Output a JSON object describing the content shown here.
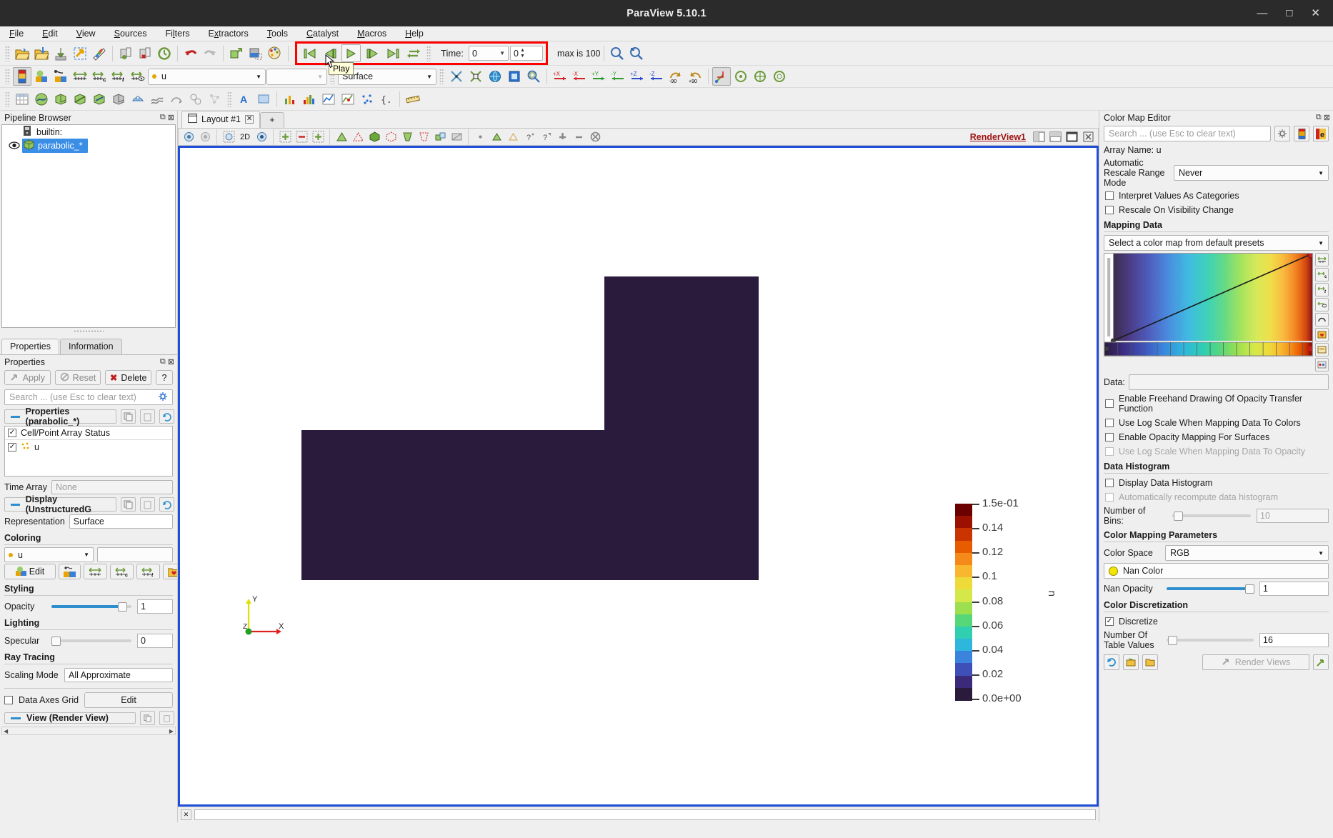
{
  "window": {
    "title": "ParaView 5.10.1",
    "minimize": "—",
    "maximize": "□",
    "close": "✕"
  },
  "menubar": {
    "items": [
      "File",
      "Edit",
      "View",
      "Sources",
      "Filters",
      "Extractors",
      "Tools",
      "Catalyst",
      "Macros",
      "Help"
    ]
  },
  "toolbar_main": {
    "icons": [
      "open-file-icon",
      "save-data-icon",
      "load-state-icon",
      "save-state-icon",
      "connect-icon",
      "disconnect-icon",
      "reset-session-icon",
      "undo-icon",
      "redo-icon",
      "camera-link-icon",
      "screenshot-icon",
      "color-palette-icon",
      "find-data-icon",
      "save-screenshot-icon"
    ]
  },
  "time_controls": {
    "highlight_color": "#ff0000",
    "first_frame": "first-frame-button",
    "previous_frame": "previous-frame-button",
    "play": "play-button",
    "next_frame": "next-frame-button",
    "last_frame": "last-frame-button",
    "loop": "loop-button",
    "time_label": "Time:",
    "time_value": "0",
    "frame_value": "0",
    "max_label": "max is 100",
    "tooltip": "Play"
  },
  "toolbar_rep": {
    "array_name": "u",
    "component_placeholder": "",
    "representation": "Surface"
  },
  "pipeline": {
    "title": "Pipeline Browser",
    "server": "builtin:",
    "source": "parabolic_*"
  },
  "properties_panel": {
    "tabs": [
      "Properties",
      "Information"
    ],
    "active_tab": "Properties",
    "title": "Properties",
    "apply_label": "Apply",
    "reset_label": "Reset",
    "delete_label": "Delete",
    "help_label": "?",
    "search_placeholder": "Search ... (use Esc to clear text)",
    "group_properties": "Properties (parabolic_*)",
    "array_status_label": "Cell/Point Array Status",
    "array_item": "u",
    "time_array_label": "Time Array",
    "time_array_value": "None",
    "group_display": "Display (UnstructuredG",
    "representation_label": "Representation",
    "representation_value": "Surface",
    "coloring_label": "Coloring",
    "coloring_value": "u",
    "edit_label": "Edit",
    "styling_label": "Styling",
    "opacity_label": "Opacity",
    "opacity_value": "1",
    "lighting_label": "Lighting",
    "specular_label": "Specular",
    "specular_value": "0",
    "ray_tracing_label": "Ray Tracing",
    "scaling_mode_label": "Scaling Mode",
    "scaling_mode_value": "All Approximate",
    "data_axes_grid_label": "Data Axes Grid",
    "data_axes_edit": "Edit",
    "view_group": "View (Render View)"
  },
  "layout": {
    "tab_label": "Layout #1",
    "tab_close": "✕",
    "add_tab": "+",
    "view_name": "RenderView1"
  },
  "render_view": {
    "background": "#ffffff",
    "geometry_color": "#2a1a3c",
    "axes": {
      "x": "X",
      "y": "Y",
      "z": "Z"
    },
    "scalar_bar": {
      "title": "u",
      "labels": [
        "1.5e-01",
        "0.14",
        "0.12",
        "0.1",
        "0.08",
        "0.06",
        "0.04",
        "0.02",
        "0.0e+00"
      ],
      "colors": [
        "#6b0000",
        "#9c1000",
        "#c93400",
        "#e85c00",
        "#f58a1a",
        "#f8b72e",
        "#eedb3a",
        "#d4e84a",
        "#9ce04f",
        "#58d77a",
        "#2fcfb0",
        "#2fb6dd",
        "#3a84dd",
        "#3f4fb8",
        "#3b2a7a",
        "#2a1a3c"
      ]
    }
  },
  "color_map_editor": {
    "title": "Color Map Editor",
    "search_placeholder": "Search ... (use Esc to clear text)",
    "array_name_label": "Array Name: u",
    "auto_rescale_label": "Automatic Rescale Range Mode",
    "auto_rescale_value": "Never",
    "interpret_categories": "Interpret Values As Categories",
    "rescale_visibility": "Rescale On Visibility Change",
    "mapping_data_label": "Mapping Data",
    "preset_value": "Select a color map from default presets",
    "data_label": "Data:",
    "data_value": "",
    "freehand_label": "Enable Freehand Drawing Of Opacity Transfer Function",
    "log_colors_label": "Use Log Scale When Mapping Data To Colors",
    "opacity_surfaces_label": "Enable Opacity Mapping For Surfaces",
    "log_opacity_label": "Use Log Scale When Mapping Data To Opacity",
    "histogram_section": "Data Histogram",
    "display_histogram_label": "Display Data Histogram",
    "auto_recompute_label": "Automatically recompute data histogram",
    "bins_label": "Number of Bins:",
    "bins_value": "10",
    "mapping_params_section": "Color Mapping Parameters",
    "color_space_label": "Color Space",
    "color_space_value": "RGB",
    "nan_color_label": "Nan Color",
    "nan_color_hex": "#f2e600",
    "nan_opacity_label": "Nan Opacity",
    "nan_opacity_value": "1",
    "discretization_section": "Color Discretization",
    "discretize_label": "Discretize",
    "table_values_label": "Number Of Table Values",
    "table_values_value": "16",
    "render_views_label": "Render Views"
  },
  "status_bar": {
    "message": ""
  }
}
